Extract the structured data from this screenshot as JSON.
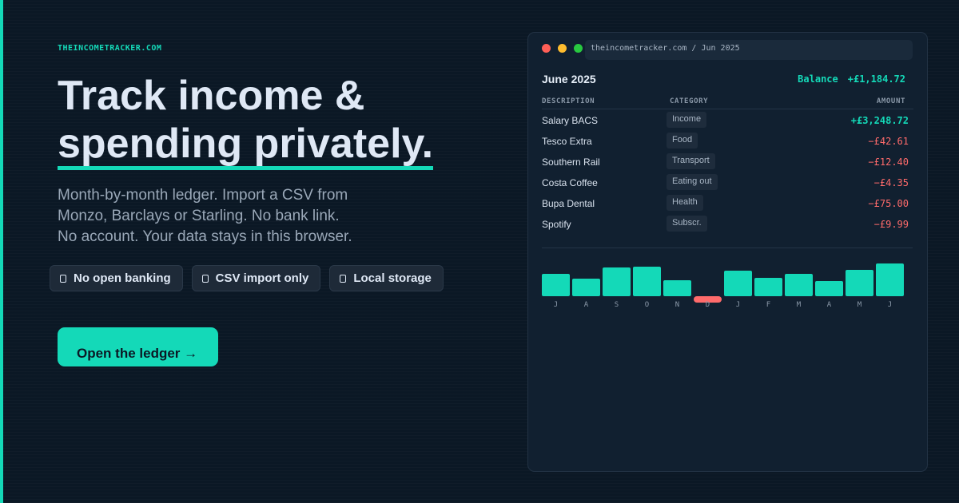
{
  "site_label": "THEINCOMETRACKER.COM",
  "headline": {
    "line1": "Track income &",
    "line2": "spending privately."
  },
  "subtext": [
    "Month-by-month ledger. Import a CSV from",
    "Monzo, Barclays or Starling. No bank link.",
    "No account. Your data stays in this browser."
  ],
  "chips": [
    {
      "label": "No open banking",
      "icon": "lock-icon"
    },
    {
      "label": "CSV import only",
      "icon": "lock-icon"
    },
    {
      "label": "Local storage",
      "icon": "lock-icon"
    }
  ],
  "cta": {
    "label": "Open the ledger →"
  },
  "window": {
    "url": "theincometracker.com / Jun 2025",
    "month": "June 2025",
    "balance_label": "Balance",
    "balance_value": "+£1,184.72",
    "columns": {
      "description": "DESCRIPTION",
      "category": "CATEGORY",
      "amount": "AMOUNT"
    },
    "rows": [
      {
        "description": "Salary BACS",
        "category": "Income",
        "amount": "+£3,248.72",
        "type": "credit"
      },
      {
        "description": "Tesco Extra",
        "category": "Food",
        "amount": "−£42.61",
        "type": "debit"
      },
      {
        "description": "Southern Rail",
        "category": "Transport",
        "amount": "−£12.40",
        "type": "debit"
      },
      {
        "description": "Costa Coffee",
        "category": "Eating out",
        "amount": "−£4.35",
        "type": "debit"
      },
      {
        "description": "Bupa Dental",
        "category": "Health",
        "amount": "−£75.00",
        "type": "debit"
      },
      {
        "description": "Spotify",
        "category": "Subscr.",
        "amount": "−£9.99",
        "type": "debit"
      }
    ],
    "chart": {
      "type": "bar",
      "months": [
        "J",
        "A",
        "S",
        "O",
        "N",
        "D",
        "J",
        "F",
        "M",
        "A",
        "M",
        "J"
      ],
      "values": [
        28,
        22,
        36,
        37,
        20,
        -4,
        32,
        23,
        28,
        19,
        33,
        41
      ]
    }
  },
  "colors": {
    "accent": "#14d9b8",
    "negative": "#ff6b6b",
    "background": "#0b1825",
    "window": "#112030"
  }
}
